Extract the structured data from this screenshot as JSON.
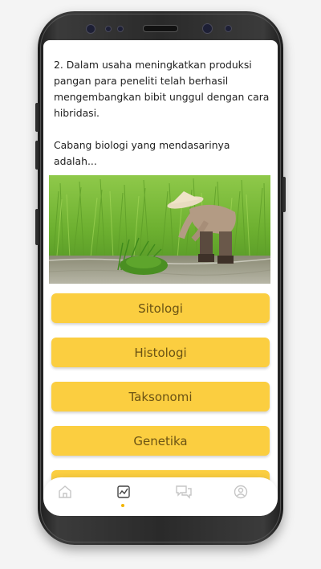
{
  "question": {
    "lines": [
      "2. Dalam usaha meningkatkan produksi",
      "pangan para peneliti telah berhasil",
      "mengembangkan bibit unggul dengan cara",
      "hibridasi."
    ],
    "prompt_lines": [
      "Cabang biologi yang mendasarinya",
      "adalah..."
    ]
  },
  "image": {
    "description_icon": "rice-field-farmer-photo"
  },
  "answers": [
    {
      "label": "Sitologi"
    },
    {
      "label": "Histologi"
    },
    {
      "label": "Taksonomi"
    },
    {
      "label": "Genetika"
    }
  ],
  "nav": {
    "items": [
      {
        "icon": "home-icon"
      },
      {
        "icon": "chart-icon",
        "active": true
      },
      {
        "icon": "chat-icon"
      },
      {
        "icon": "user-icon"
      }
    ]
  },
  "colors": {
    "answer_bg": "#fbce40",
    "answer_text": "#6b5314",
    "active_dot": "#f2b500"
  }
}
